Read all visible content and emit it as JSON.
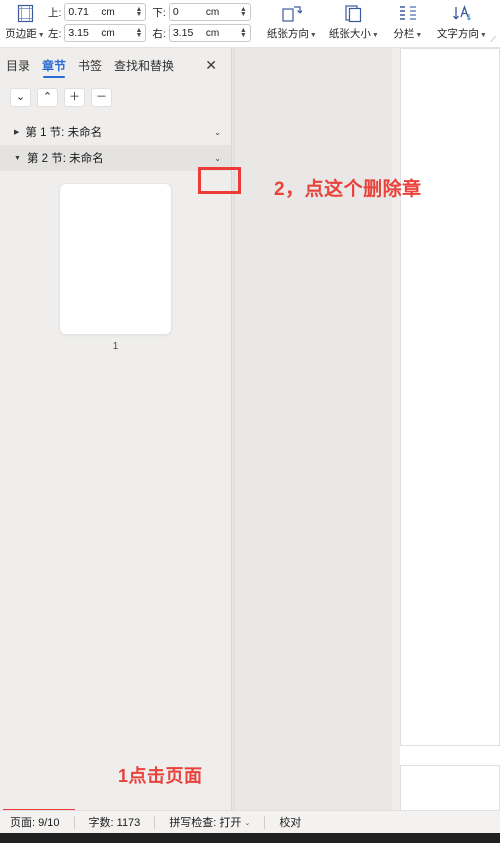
{
  "ribbon": {
    "margins": {
      "label": "页边距",
      "icon": "page-margins-icon",
      "has_caret": true
    },
    "fields": [
      {
        "label": "上:",
        "value": "0.71",
        "unit": "cm",
        "name": "margin-top-field"
      },
      {
        "label": "下:",
        "value": "0",
        "unit": "cm",
        "name": "margin-bottom-field"
      },
      {
        "label": "左:",
        "value": "3.15",
        "unit": "cm",
        "name": "margin-left-field"
      },
      {
        "label": "右:",
        "value": "3.15",
        "unit": "cm",
        "name": "margin-right-field"
      }
    ],
    "buttons": [
      {
        "label": "纸张方向",
        "icon": "paper-orientation-icon",
        "has_caret": true
      },
      {
        "label": "纸张大小",
        "icon": "paper-size-icon",
        "has_caret": true
      },
      {
        "label": "分栏",
        "icon": "columns-icon",
        "has_caret": true
      },
      {
        "label": "文字方向",
        "icon": "text-direction-icon",
        "has_caret": true
      }
    ],
    "dialog_launcher": "⟋"
  },
  "nav_pane": {
    "tabs": [
      {
        "label": "目录",
        "active": false
      },
      {
        "label": "章节",
        "active": true
      },
      {
        "label": "书签",
        "active": false
      },
      {
        "label": "查找和替换",
        "active": false
      }
    ],
    "close_label": "✕",
    "toolbar": [
      {
        "glyph": "⌄",
        "name": "move-down-button"
      },
      {
        "glyph": "⌃",
        "name": "move-up-button"
      },
      {
        "glyph": "＋",
        "name": "add-section-button"
      },
      {
        "glyph": "－",
        "name": "remove-section-button"
      }
    ],
    "sections": [
      {
        "triangle": "▶",
        "name": "第 1 节: 未命名",
        "menu": "⌄",
        "selected": false
      },
      {
        "triangle": "▼",
        "name": "第 2 节: 未命名",
        "menu": "⌄",
        "selected": true
      }
    ],
    "thumbnail": {
      "page_label": "1"
    }
  },
  "annotations": {
    "step2": "2，点这个删除章",
    "step1": "1点击页面"
  },
  "status_bar": {
    "page": "页面: 9/10",
    "words": "字数: 1173",
    "spellcheck": "拼写检查: 打开",
    "spellcheck_caret": "⌄",
    "proofread": "校对"
  },
  "colors": {
    "accent": "#2b6cd4",
    "annotation_red": "#e8423b",
    "pane_bg": "#efeeed",
    "selected_row": "#e4e3e2"
  }
}
